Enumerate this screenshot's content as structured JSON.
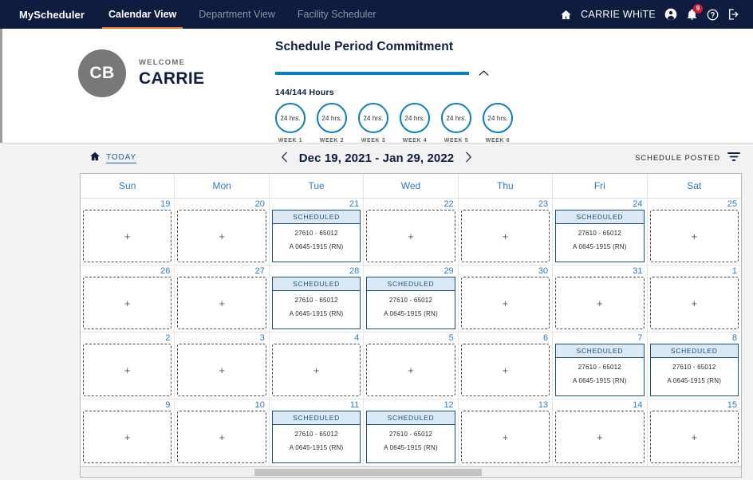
{
  "nav": {
    "brand": "MyScheduler",
    "tabs": [
      {
        "label": "Calendar View",
        "active": true
      },
      {
        "label": "Department View",
        "active": false
      },
      {
        "label": "Facility Scheduler",
        "active": false
      }
    ],
    "user_name": "CARRIE WHiTE",
    "notification_count": "9",
    "icons": [
      "home-icon",
      "account-icon",
      "notification-bell-icon",
      "help-icon",
      "logout-icon"
    ],
    "background_color": "#101c3f",
    "active_tab_accent": "#e8762a"
  },
  "welcome": {
    "avatar_initials": "CB",
    "greeting_label": "WELCOME",
    "user_first_name": "CARRIE",
    "avatar_color": "#787878"
  },
  "commitment": {
    "title": "Schedule Period Commitment",
    "progress_percent": 100,
    "hours_text": "144/144 Hours",
    "accent_color": "#0a7fc2",
    "collapse_icon": "chevron-up-icon",
    "weeks": [
      {
        "hours": "24 hrs.",
        "label": "WEEK 1"
      },
      {
        "hours": "24 hrs.",
        "label": "WEEK 2"
      },
      {
        "hours": "24 hrs.",
        "label": "WEEK 3"
      },
      {
        "hours": "24 hrs.",
        "label": "WEEK 4"
      },
      {
        "hours": "24 hrs.",
        "label": "WEEK 5"
      },
      {
        "hours": "24 hrs.",
        "label": "WEEK 6"
      }
    ]
  },
  "toolbar": {
    "today_label": "TODAY",
    "home_icon": "home-icon",
    "prev_icon": "chevron-left-icon",
    "next_icon": "chevron-right-icon",
    "date_range": "Dec 19, 2021 - Jan 29, 2022",
    "status_label": "SCHEDULE POSTED",
    "filter_icon": "filter-icon"
  },
  "calendar": {
    "day_headers": [
      "Sun",
      "Mon",
      "Tue",
      "Wed",
      "Thu",
      "Fri",
      "Sat"
    ],
    "add_glyph": "+",
    "scheduled_header": "SCHEDULED",
    "shift_code": "27610 - 65012",
    "shift_time": "A 0645-1915 (RN)",
    "scheduled_border_color": "#1b4f7e",
    "scheduled_header_bg": "#dbe9f5",
    "weeks": [
      [
        {
          "day": "19",
          "scheduled": false
        },
        {
          "day": "20",
          "scheduled": false
        },
        {
          "day": "21",
          "scheduled": true,
          "status": "SCHEDULED",
          "code": "27610 - 65012",
          "time": "A 0645-1915 (RN)"
        },
        {
          "day": "22",
          "scheduled": false
        },
        {
          "day": "23",
          "scheduled": false
        },
        {
          "day": "24",
          "scheduled": true,
          "status": "SCHEDULED",
          "code": "27610 - 65012",
          "time": "A 0645-1915 (RN)"
        },
        {
          "day": "25",
          "scheduled": false
        }
      ],
      [
        {
          "day": "26",
          "scheduled": false
        },
        {
          "day": "27",
          "scheduled": false
        },
        {
          "day": "28",
          "scheduled": true,
          "status": "SCHEDULED",
          "code": "27610 - 65012",
          "time": "A 0645-1915 (RN)"
        },
        {
          "day": "29",
          "scheduled": true,
          "status": "SCHEDULED",
          "code": "27610 - 65012",
          "time": "A 0645-1915 (RN)"
        },
        {
          "day": "30",
          "scheduled": false
        },
        {
          "day": "31",
          "scheduled": false
        },
        {
          "day": "1",
          "scheduled": false
        }
      ],
      [
        {
          "day": "2",
          "scheduled": false
        },
        {
          "day": "3",
          "scheduled": false
        },
        {
          "day": "4",
          "scheduled": false
        },
        {
          "day": "5",
          "scheduled": false
        },
        {
          "day": "6",
          "scheduled": false
        },
        {
          "day": "7",
          "scheduled": true,
          "status": "SCHEDULED",
          "code": "27610 - 65012",
          "time": "A 0645-1915 (RN)"
        },
        {
          "day": "8",
          "scheduled": true,
          "status": "SCHEDULED",
          "code": "27610 - 65012",
          "time": "A 0645-1915 (RN)"
        }
      ],
      [
        {
          "day": "9",
          "scheduled": false
        },
        {
          "day": "10",
          "scheduled": false
        },
        {
          "day": "11",
          "scheduled": true,
          "status": "SCHEDULED",
          "code": "27610 - 65012",
          "time": "A 0645-1915 (RN)"
        },
        {
          "day": "12",
          "scheduled": true,
          "status": "SCHEDULED",
          "code": "27610 - 65012",
          "time": "A 0645-1915 (RN)"
        },
        {
          "day": "13",
          "scheduled": false
        },
        {
          "day": "14",
          "scheduled": false
        },
        {
          "day": "15",
          "scheduled": false
        }
      ]
    ]
  }
}
